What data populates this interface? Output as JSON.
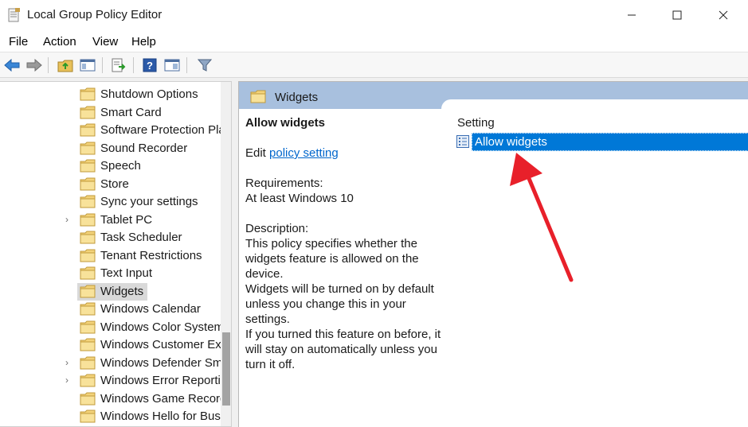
{
  "window": {
    "title": "Local Group Policy Editor"
  },
  "menu": {
    "items": [
      "File",
      "Action",
      "View",
      "Help"
    ]
  },
  "tree": {
    "items": [
      {
        "label": "Shutdown Options",
        "expandable": false
      },
      {
        "label": "Smart Card",
        "expandable": false
      },
      {
        "label": "Software Protection Pla",
        "expandable": false
      },
      {
        "label": "Sound Recorder",
        "expandable": false
      },
      {
        "label": "Speech",
        "expandable": false
      },
      {
        "label": "Store",
        "expandable": false
      },
      {
        "label": "Sync your settings",
        "expandable": false
      },
      {
        "label": "Tablet PC",
        "expandable": true
      },
      {
        "label": "Task Scheduler",
        "expandable": false
      },
      {
        "label": "Tenant Restrictions",
        "expandable": false
      },
      {
        "label": "Text Input",
        "expandable": false
      },
      {
        "label": "Widgets",
        "expandable": false,
        "selected": true
      },
      {
        "label": "Windows Calendar",
        "expandable": false
      },
      {
        "label": "Windows Color System",
        "expandable": false
      },
      {
        "label": "Windows Customer Ex",
        "expandable": false
      },
      {
        "label": "Windows Defender Sm",
        "expandable": true
      },
      {
        "label": "Windows Error Reporti",
        "expandable": true
      },
      {
        "label": "Windows Game Record",
        "expandable": false
      },
      {
        "label": "Windows Hello for Bus",
        "expandable": false
      }
    ],
    "expander_glyph": "›"
  },
  "content": {
    "header_title": "Widgets",
    "policy_title": "Allow widgets",
    "edit_prefix": "Edit ",
    "edit_link": "policy setting ",
    "requirements_label": "Requirements:",
    "requirements_value": "At least Windows 10",
    "description_label": "Description:",
    "description_lines": [
      "This policy specifies whether the",
      "widgets feature is allowed on the",
      "device.",
      "Widgets will be turned on by default",
      "unless you change this in your",
      "settings.",
      "If you turned this feature on before, it",
      "will stay on automatically unless you",
      "turn it off."
    ],
    "setting_column": "Setting",
    "settings": [
      "Allow widgets"
    ]
  },
  "colors": {
    "selection": "#0078d7",
    "header": "#a8c0de",
    "link": "#0066cc",
    "arrow": "#e8202a"
  }
}
